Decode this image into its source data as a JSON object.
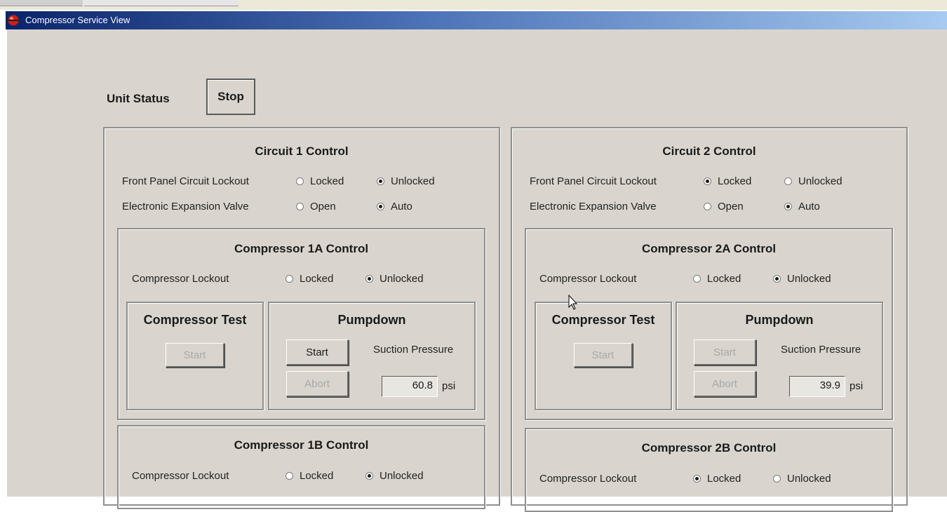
{
  "window": {
    "title": "Compressor Service View",
    "app_icon": "red-sphere-icon"
  },
  "unit_status": {
    "label": "Unit Status",
    "value": "Stop"
  },
  "circuits": [
    {
      "title": "Circuit 1 Control",
      "front_panel": {
        "label": "Front Panel Circuit Lockout",
        "opt1": "Locked",
        "opt2": "Unlocked",
        "selected": "Unlocked"
      },
      "eev": {
        "label": "Electronic Expansion Valve",
        "opt1": "Open",
        "opt2": "Auto",
        "selected": "Auto"
      },
      "compA": {
        "title": "Compressor 1A Control",
        "lockout": {
          "label": "Compressor Lockout",
          "opt1": "Locked",
          "opt2": "Unlocked",
          "selected": "Unlocked"
        },
        "test": {
          "title": "Compressor Test",
          "start": "Start"
        },
        "pumpdown": {
          "title": "Pumpdown",
          "start": "Start",
          "abort": "Abort",
          "suction_label": "Suction Pressure",
          "value": "60.8",
          "unit": "psi"
        }
      },
      "compB": {
        "title": "Compressor 1B Control",
        "lockout": {
          "label": "Compressor Lockout",
          "opt1": "Locked",
          "opt2": "Unlocked",
          "selected": "Unlocked"
        }
      }
    },
    {
      "title": "Circuit 2 Control",
      "front_panel": {
        "label": "Front Panel Circuit Lockout",
        "opt1": "Locked",
        "opt2": "Unlocked",
        "selected": "Locked"
      },
      "eev": {
        "label": "Electronic Expansion Valve",
        "opt1": "Open",
        "opt2": "Auto",
        "selected": "Auto"
      },
      "compA": {
        "title": "Compressor 2A Control",
        "lockout": {
          "label": "Compressor Lockout",
          "opt1": "Locked",
          "opt2": "Unlocked",
          "selected": "Unlocked"
        },
        "test": {
          "title": "Compressor Test",
          "start": "Start"
        },
        "pumpdown": {
          "title": "Pumpdown",
          "start": "Start",
          "abort": "Abort",
          "suction_label": "Suction Pressure",
          "value": "39.9",
          "unit": "psi"
        }
      },
      "compB": {
        "title": "Compressor 2B Control",
        "lockout": {
          "label": "Compressor Lockout",
          "opt1": "Locked",
          "opt2": "Unlocked",
          "selected": "Locked"
        }
      }
    }
  ]
}
